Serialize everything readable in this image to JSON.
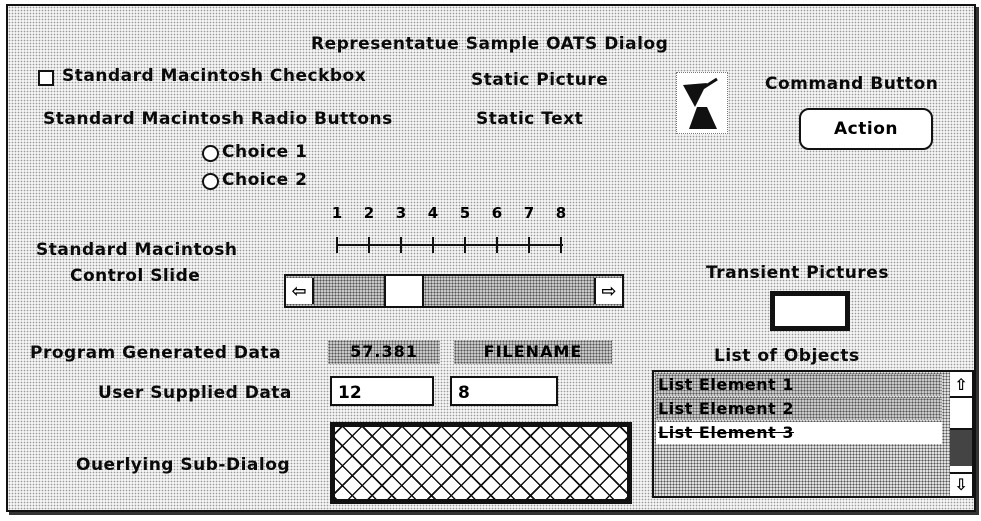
{
  "dialog": {
    "title": "Representatue Sample OATS Dialog"
  },
  "checkbox": {
    "label": "Standard Macintosh Checkbox",
    "checked": false
  },
  "radio": {
    "label": "Standard Macintosh Radio Buttons",
    "choices": [
      "Choice 1",
      "Choice 2"
    ]
  },
  "static": {
    "picture_label": "Static Picture",
    "text_label": "Static Text",
    "picture_icon": "radar-dish-icon"
  },
  "command": {
    "label": "Command Button",
    "button": "Action"
  },
  "slider": {
    "label_line1": "Standard Macintosh",
    "label_line2": "Control Slide",
    "ticks": [
      "1",
      "2",
      "3",
      "4",
      "5",
      "6",
      "7",
      "8"
    ],
    "left_arrow": "⇦",
    "right_arrow": "⇨"
  },
  "transient": {
    "label": "Transient Pictures"
  },
  "generated": {
    "label": "Program Generated Data",
    "value1": "57.381",
    "value2": "FILENAME"
  },
  "supplied": {
    "label": "User Supplied Data",
    "value1": "12",
    "value2": "8"
  },
  "subdialog": {
    "label": "Ouerlying Sub-Dialog"
  },
  "list": {
    "label": "List of Objects",
    "items": [
      "List Element 1",
      "List Element 2",
      "List Element 3"
    ],
    "up_arrow": "⇧",
    "down_arrow": "⇩"
  }
}
